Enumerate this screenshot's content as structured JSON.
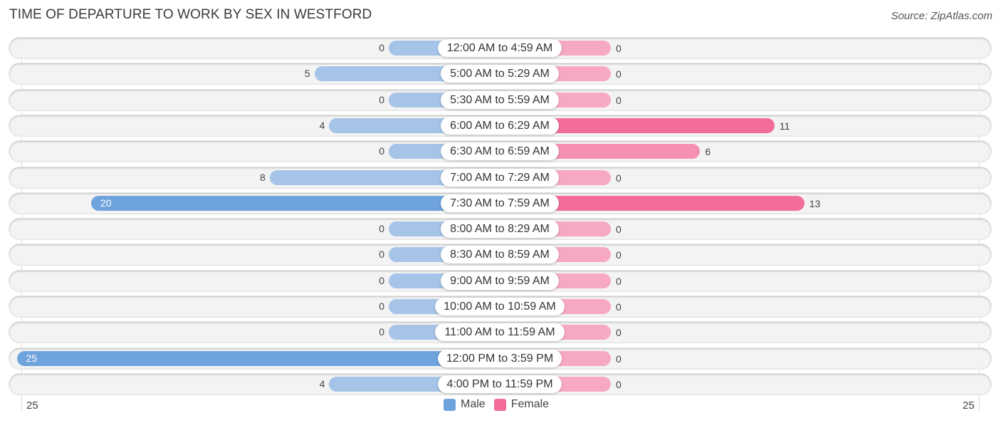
{
  "header": {
    "title": "TIME OF DEPARTURE TO WORK BY SEX IN WESTFORD",
    "source": "Source: ZipAtlas.com"
  },
  "colors": {
    "male": "#6fa3dd",
    "male_light": "#a5c4e8",
    "female": "#f26e98",
    "female_light": "#f7a9c3",
    "row_background": "#f3f3f3"
  },
  "chart_data": {
    "type": "bar",
    "orientation": "horizontal-diverging",
    "title": "TIME OF DEPARTURE TO WORK BY SEX IN WESTFORD",
    "categories": [
      "12:00 AM to 4:59 AM",
      "5:00 AM to 5:29 AM",
      "5:30 AM to 5:59 AM",
      "6:00 AM to 6:29 AM",
      "6:30 AM to 6:59 AM",
      "7:00 AM to 7:29 AM",
      "7:30 AM to 7:59 AM",
      "8:00 AM to 8:29 AM",
      "8:30 AM to 8:59 AM",
      "9:00 AM to 9:59 AM",
      "10:00 AM to 10:59 AM",
      "11:00 AM to 11:59 AM",
      "12:00 PM to 3:59 PM",
      "4:00 PM to 11:59 PM"
    ],
    "series": [
      {
        "name": "Male",
        "values": [
          0,
          5,
          0,
          4,
          0,
          8,
          20,
          0,
          0,
          0,
          0,
          0,
          25,
          4
        ]
      },
      {
        "name": "Female",
        "values": [
          0,
          0,
          0,
          11,
          6,
          0,
          13,
          0,
          0,
          0,
          0,
          0,
          0,
          0
        ]
      }
    ],
    "axis": {
      "left_max_label": "25",
      "right_max_label": "25",
      "range": [
        0,
        25
      ]
    },
    "legend": {
      "position": "bottom-center",
      "entries": [
        "Male",
        "Female"
      ]
    }
  }
}
